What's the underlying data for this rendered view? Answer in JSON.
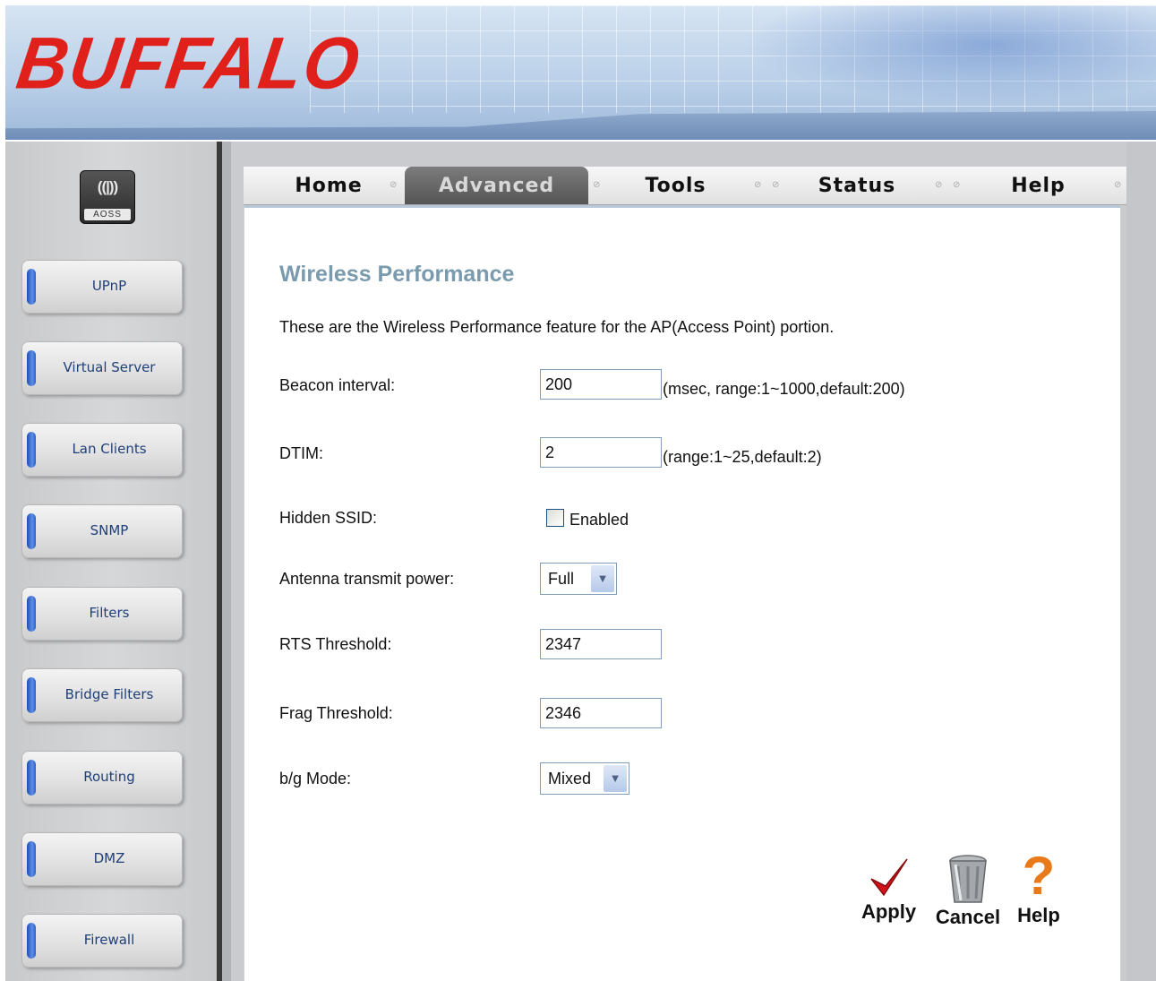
{
  "header": {
    "logo_text": "BUFFALO"
  },
  "aoss": {
    "waves": "((|))",
    "label": "AOSS"
  },
  "sidebar": {
    "items": [
      {
        "label": "UPnP"
      },
      {
        "label": "Virtual Server"
      },
      {
        "label": "Lan Clients"
      },
      {
        "label": "SNMP"
      },
      {
        "label": "Filters"
      },
      {
        "label": "Bridge Filters"
      },
      {
        "label": "Routing"
      },
      {
        "label": "DMZ"
      },
      {
        "label": "Firewall"
      }
    ]
  },
  "tabs": {
    "items": [
      {
        "label": "Home"
      },
      {
        "label": "Advanced"
      },
      {
        "label": "Tools"
      },
      {
        "label": "Status"
      },
      {
        "label": "Help"
      }
    ],
    "active": "Advanced"
  },
  "main": {
    "title": "Wireless Performance",
    "description": "These are the Wireless Performance feature for the AP(Access Point) portion.",
    "beacon": {
      "label": "Beacon interval:",
      "value": "200",
      "hint": "(msec, range:1~1000,default:200)"
    },
    "dtim": {
      "label": "DTIM:",
      "value": "2",
      "hint": "(range:1~25,default:2)"
    },
    "hidden_ssid": {
      "label": "Hidden SSID:",
      "checkbox_label": "Enabled",
      "checked": false
    },
    "antenna": {
      "label": "Antenna transmit power:",
      "value": "Full"
    },
    "rts": {
      "label": "RTS Threshold:",
      "value": "2347"
    },
    "frag": {
      "label": "Frag Threshold:",
      "value": "2346"
    },
    "bg_mode": {
      "label": "b/g Mode:",
      "value": "Mixed"
    }
  },
  "actions": {
    "apply": "Apply",
    "cancel": "Cancel",
    "help": "Help"
  },
  "colors": {
    "logo": "#e0201b",
    "title": "#7a9aae",
    "nav_text": "#1f3f78",
    "apply_check": "#d0141a",
    "help_mark": "#e87a1a"
  }
}
